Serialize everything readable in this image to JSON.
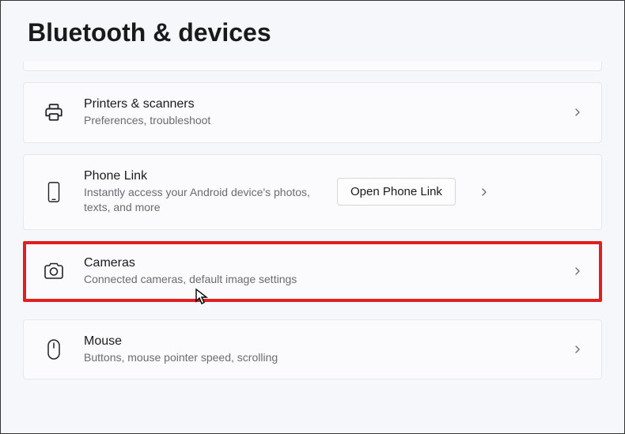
{
  "page": {
    "title": "Bluetooth & devices"
  },
  "items": {
    "printers": {
      "title": "Printers & scanners",
      "subtitle": "Preferences, troubleshoot"
    },
    "phone": {
      "title": "Phone Link",
      "subtitle": "Instantly access your Android device's photos, texts, and more",
      "action": "Open Phone Link"
    },
    "cameras": {
      "title": "Cameras",
      "subtitle": "Connected cameras, default image settings"
    },
    "mouse": {
      "title": "Mouse",
      "subtitle": "Buttons, mouse pointer speed, scrolling"
    }
  }
}
